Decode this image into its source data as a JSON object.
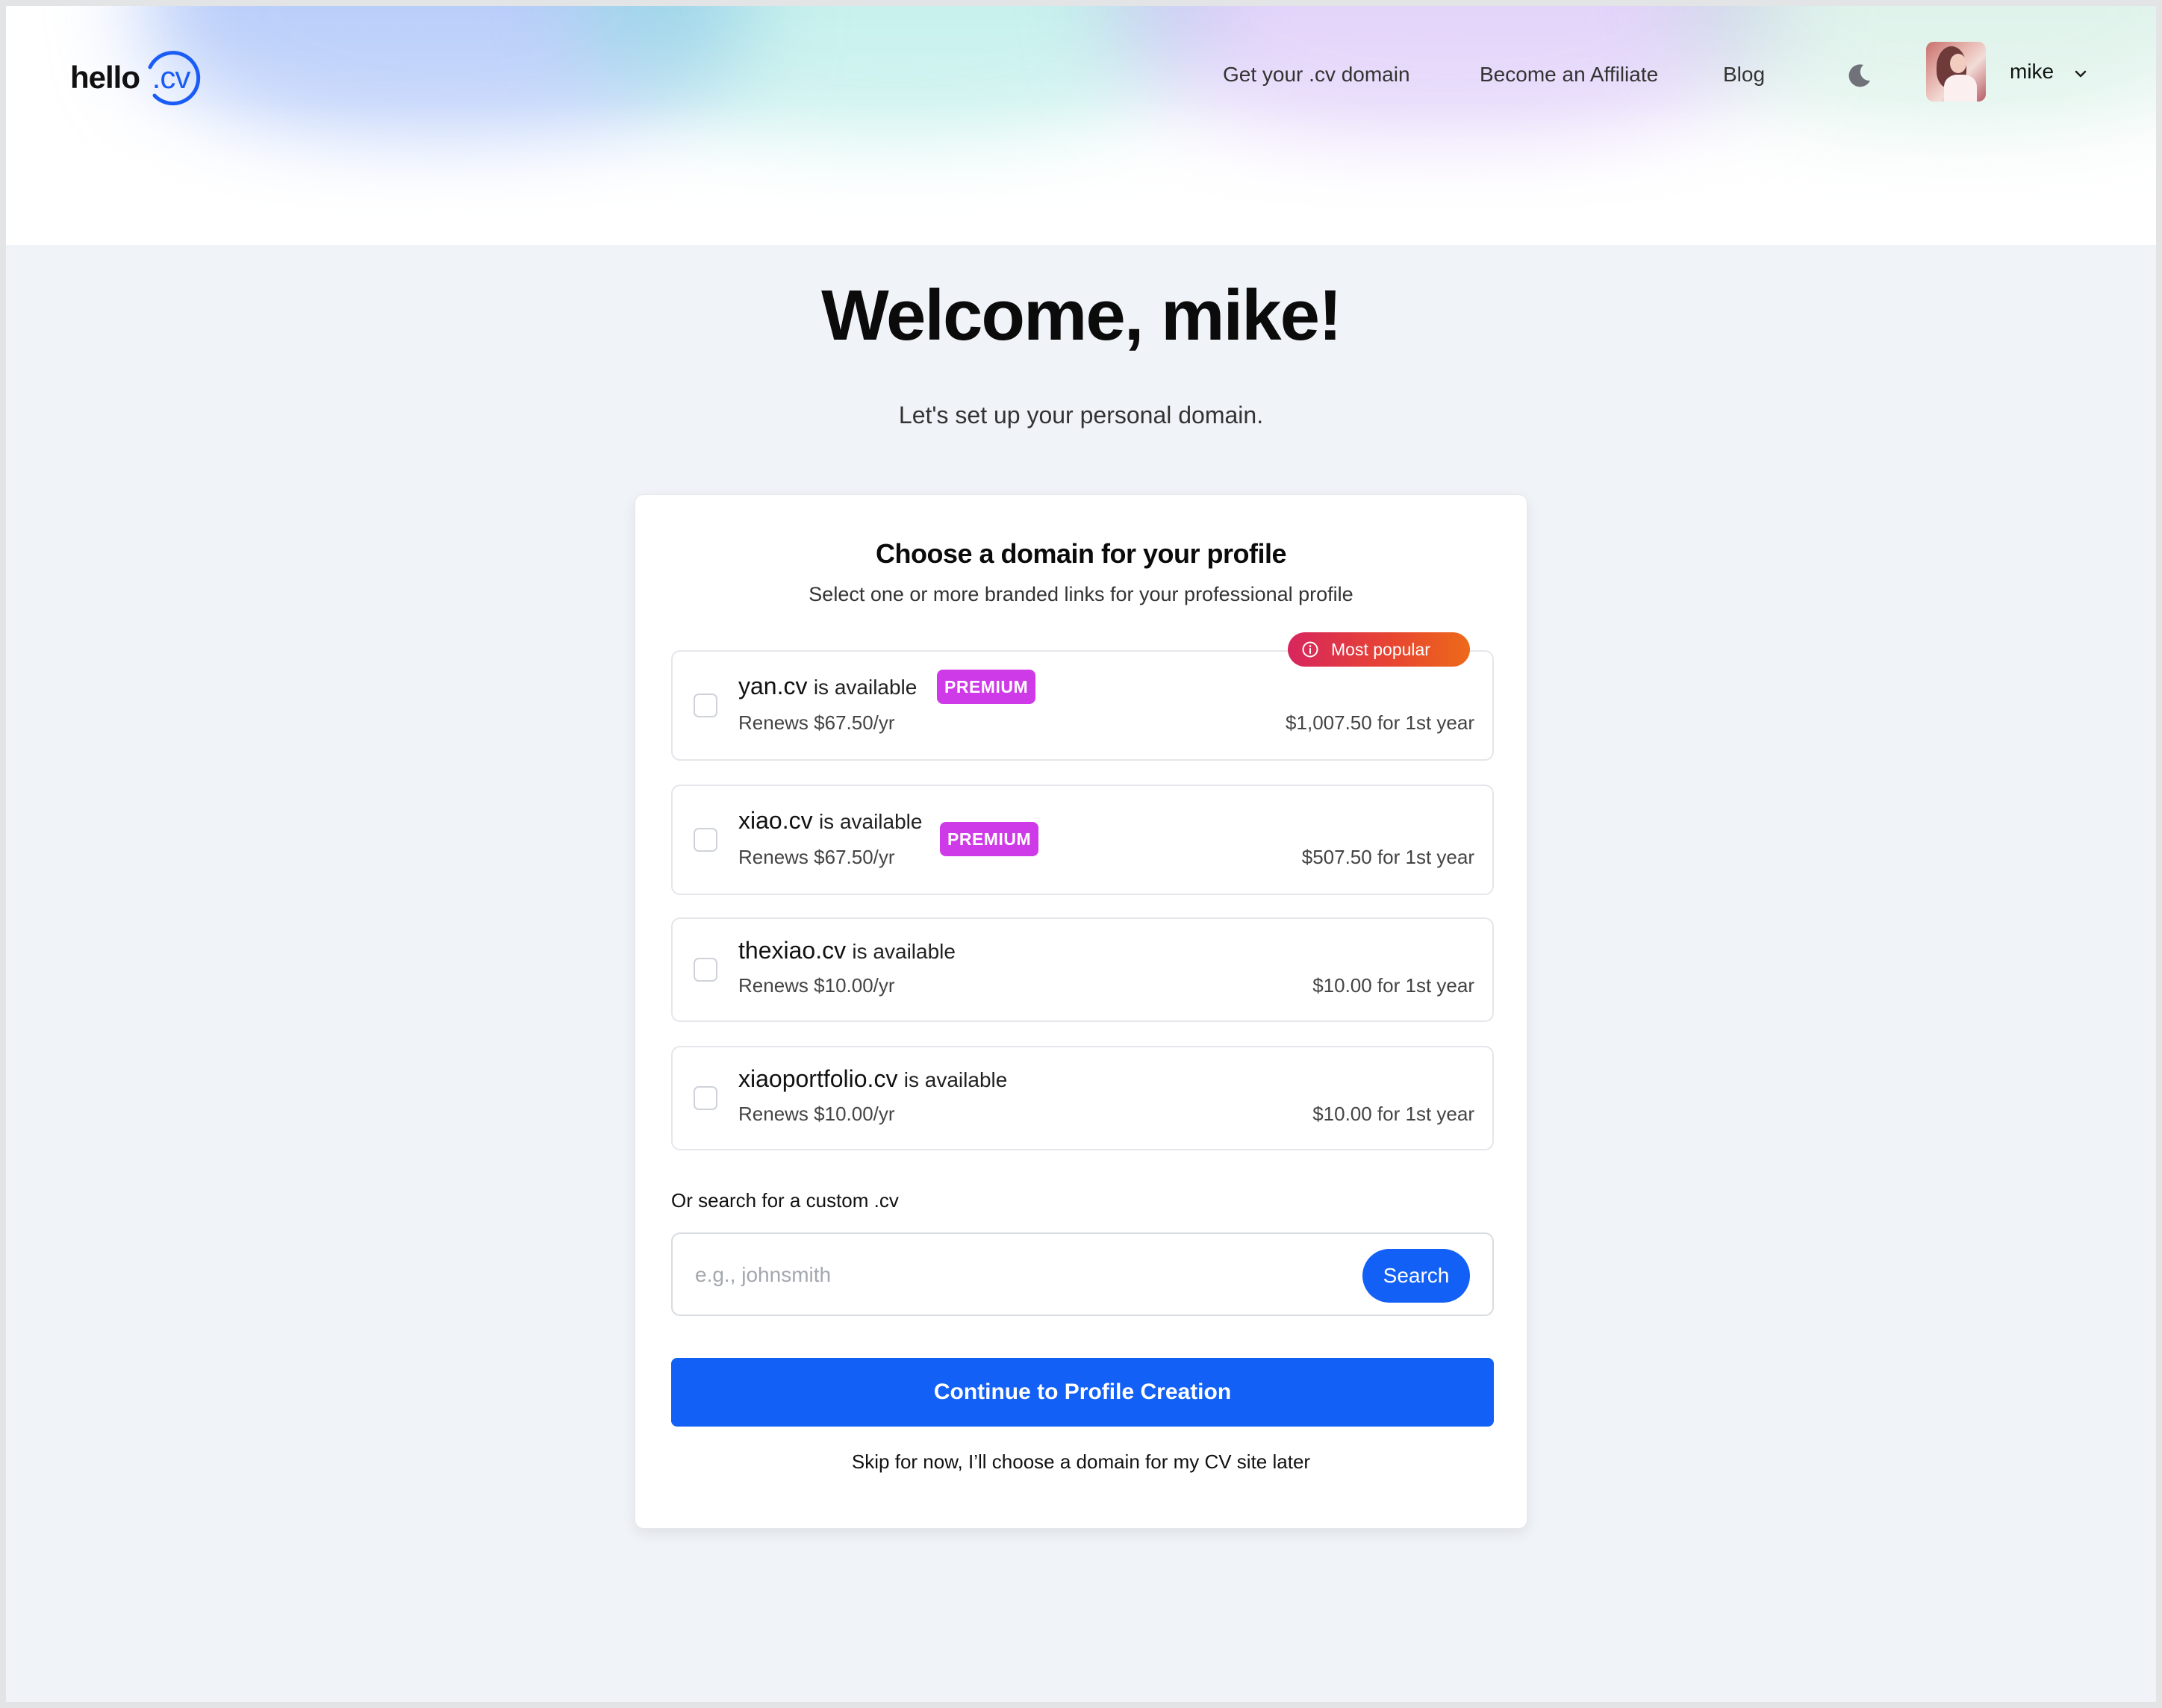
{
  "header": {
    "logo_text": "hello",
    "logo_accent": ".cv",
    "nav": [
      {
        "label": "Get your .cv domain"
      },
      {
        "label": "Become an Affiliate"
      },
      {
        "label": "Blog"
      }
    ],
    "theme_toggle_icon": "moon-icon",
    "user": {
      "name": "mike",
      "menu_icon": "chevron-down-icon"
    }
  },
  "welcome": {
    "title": "Welcome, mike!",
    "subtitle": "Let's set up your personal domain."
  },
  "card": {
    "title": "Choose a domain for your profile",
    "subtitle": "Select one or more branded links for your professional profile",
    "popular_badge": "Most popular",
    "options": [
      {
        "domain": "yan.cv",
        "status": "is available",
        "badge": "PREMIUM",
        "renew": "Renews $67.50/yr",
        "price": "$1,007.50 for 1st year",
        "checked": false
      },
      {
        "domain": "xiao.cv",
        "status": "is available",
        "badge": "PREMIUM",
        "renew": "Renews $67.50/yr",
        "price": "$507.50 for 1st year",
        "checked": false
      },
      {
        "domain": "thexiao.cv",
        "status": "is available",
        "badge": "",
        "renew": "Renews $10.00/yr",
        "price": "$10.00 for 1st year",
        "checked": false
      },
      {
        "domain": "xiaoportfolio.cv",
        "status": "is available",
        "badge": "",
        "renew": "Renews $10.00/yr",
        "price": "$10.00 for 1st year",
        "checked": false
      }
    ],
    "search": {
      "label": "Or search for a custom .cv",
      "placeholder": "e.g., johnsmith",
      "value": "",
      "button": "Search"
    },
    "continue_button": "Continue to Profile Creation",
    "skip_link": "Skip for now, I’ll choose a domain for my CV site later"
  },
  "colors": {
    "primary": "#1260f5",
    "premium": "#cf3ae8",
    "popular_start": "#d7265e",
    "popular_end": "#ed6a1a",
    "background": "#f0f3f8"
  }
}
